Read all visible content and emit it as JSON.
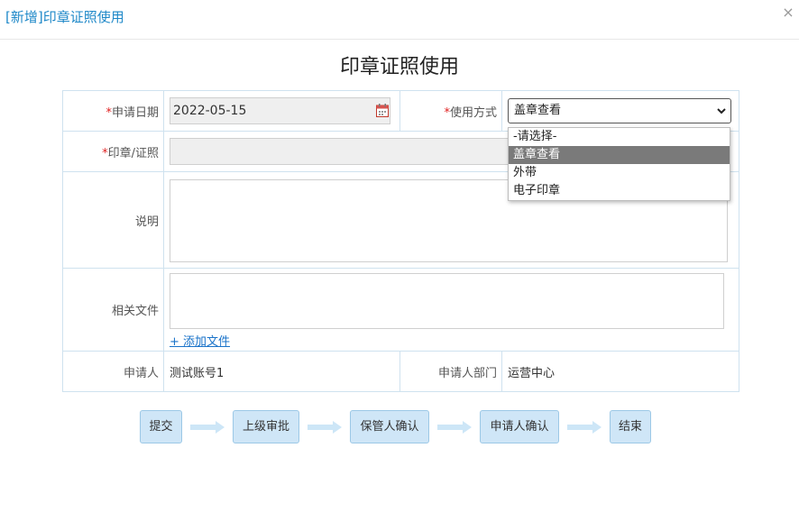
{
  "window": {
    "title": "[新增]印章证照使用",
    "close_glyph": "×"
  },
  "form": {
    "heading": "印章证照使用",
    "required_mark": "*",
    "apply_date": {
      "label": "申请日期",
      "value": "2022-05-15"
    },
    "usage_method": {
      "label": "使用方式",
      "value": "盖章查看"
    },
    "seal": {
      "label": "印章/证照",
      "value": ""
    },
    "description": {
      "label": "说明",
      "value": ""
    },
    "files": {
      "label": "相关文件",
      "add_link": "+ 添加文件"
    },
    "applicant": {
      "label": "申请人",
      "value": "测试账号1"
    },
    "department": {
      "label": "申请人部门",
      "value": "运营中心"
    }
  },
  "dropdown": {
    "options": [
      "-请选择-",
      "盖章查看",
      "外带",
      "电子印章"
    ],
    "selected_index": 1
  },
  "workflow": {
    "steps": [
      "提交",
      "上级审批",
      "保管人确认",
      "申请人确认",
      "结束"
    ]
  },
  "colors": {
    "title": "#1e88c8",
    "required": "#e02020",
    "link": "#1a73c9",
    "step_fill": "#cfe6f7",
    "arrow": "#cde6f7"
  }
}
